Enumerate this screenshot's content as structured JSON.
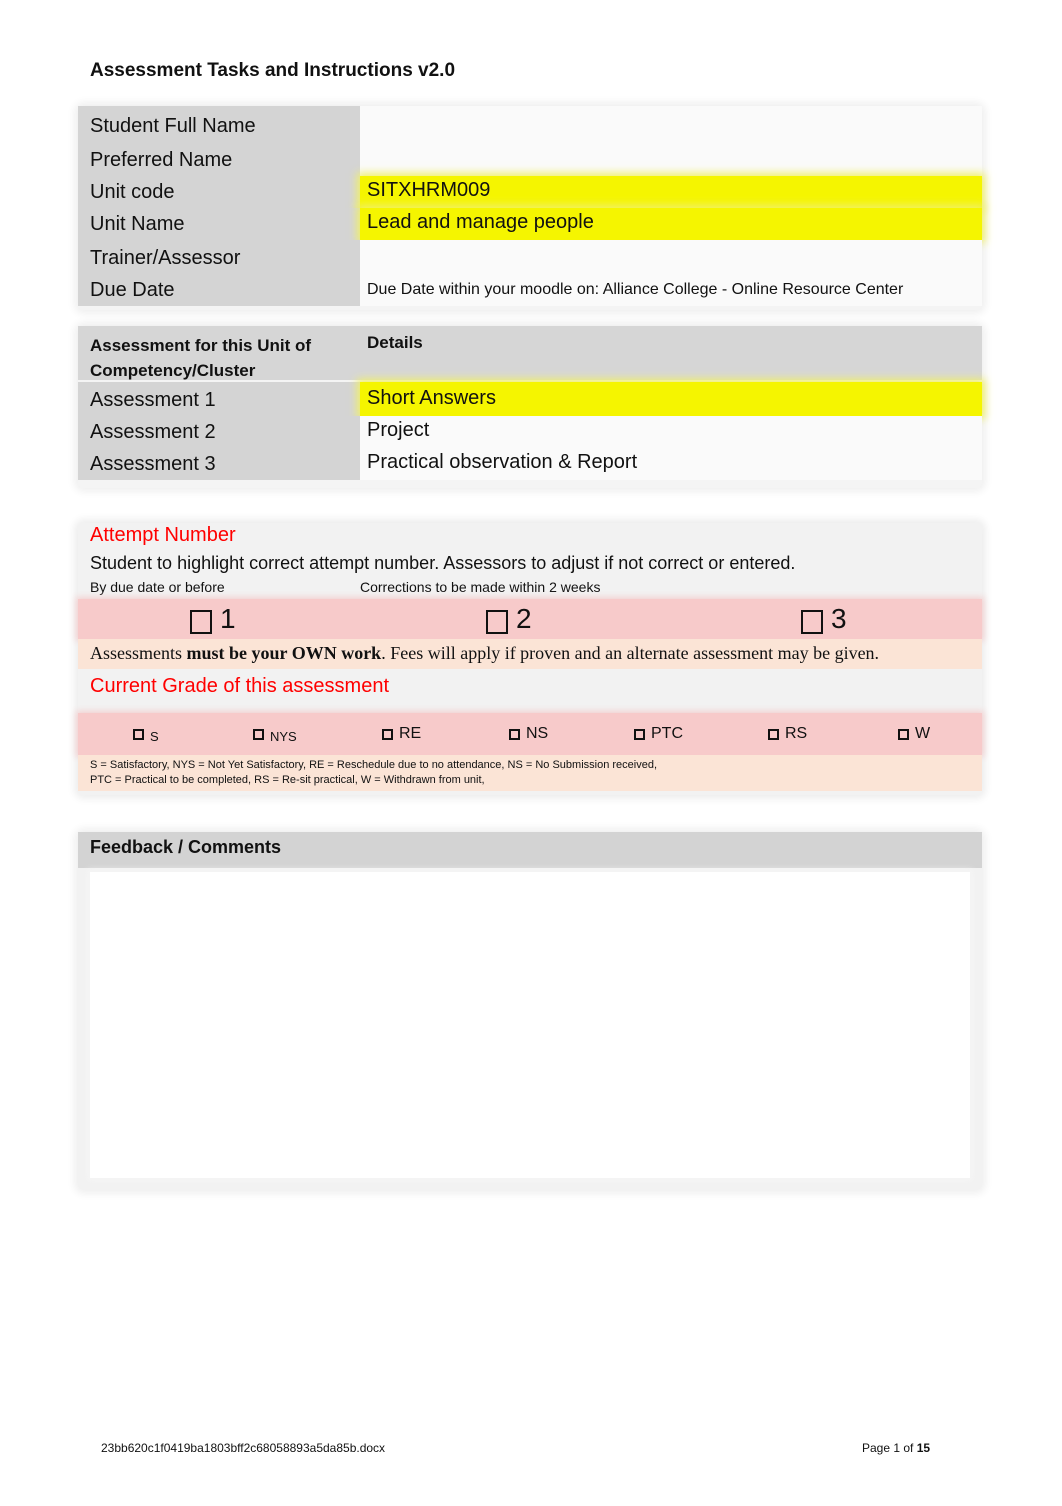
{
  "document": {
    "title": "Assessment Tasks and Instructions v2.0"
  },
  "student_info": {
    "rows": [
      {
        "label": "Student Full Name",
        "value": ""
      },
      {
        "label": "Preferred Name",
        "value": ""
      },
      {
        "label": "Unit code",
        "value": "SITXHRM009",
        "highlight": true
      },
      {
        "label": "Unit Name",
        "value": "Lead and manage people",
        "highlight": true
      },
      {
        "label": "Trainer/Assessor",
        "value": ""
      },
      {
        "label": "Due Date",
        "value": "Due Date within your moodle on: Alliance College - Online Resource Center"
      }
    ]
  },
  "assessments": {
    "header_label": "Assessment for this Unit of Competency/Cluster",
    "header_label_line1": "Assessment for this Unit of",
    "header_label_line2": "Competency/Cluster",
    "header_details": "Details",
    "rows": [
      {
        "label": "Assessment 1",
        "value": "Short Answers",
        "highlight": true
      },
      {
        "label": "Assessment 2",
        "value": "Project"
      },
      {
        "label": "Assessment 3",
        "value": "Practical observation & Report"
      }
    ]
  },
  "attempt": {
    "title": "Attempt Number",
    "instruction": "Student to highlight correct attempt number. Assessors to adjust if not correct or entered.",
    "note_left": "By due date or before",
    "note_mid": "Corrections to be made within 2 weeks",
    "options": [
      {
        "label": "1",
        "checked": false
      },
      {
        "label": "2",
        "checked": false
      },
      {
        "label": "3",
        "checked": false
      }
    ],
    "own_work_prefix": "Assessments ",
    "own_work_bold": "must be your OWN work",
    "own_work_suffix": ". Fees will apply if proven and an alternate assessment may be given."
  },
  "grade": {
    "title": "Current Grade of this assessment",
    "options": [
      {
        "label": "S",
        "checked": false
      },
      {
        "label": "NYS",
        "checked": false
      },
      {
        "label": "RE",
        "checked": false
      },
      {
        "label": "NS",
        "checked": false
      },
      {
        "label": "PTC",
        "checked": false
      },
      {
        "label": "RS",
        "checked": false
      },
      {
        "label": "W",
        "checked": false
      }
    ],
    "legend_line1": "S = Satisfactory, NYS = Not Yet Satisfactory, RE = Reschedule due to no attendance, NS = No Submission received,",
    "legend_line2": "PTC = Practical to be completed, RS = Re-sit practical, W = Withdrawn from unit,"
  },
  "feedback": {
    "title": "Feedback / Comments",
    "value": ""
  },
  "footer": {
    "filename": "23bb620c1f0419ba1803bff2c68058893a5da85b.docx",
    "page_prefix": "Page 1 of ",
    "page_total": "15"
  },
  "colors": {
    "highlight_yellow": "#f5f500",
    "attempt_red": "#ff0000",
    "label_gray": "#d4d4d4",
    "pink_band": "#f7caca",
    "peach_band": "#fbe4d6"
  }
}
